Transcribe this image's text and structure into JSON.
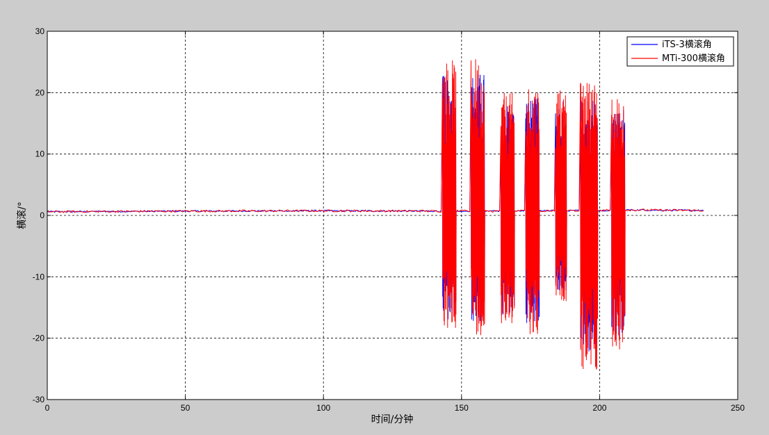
{
  "chart_data": {
    "type": "line",
    "title": "",
    "xlabel": "时间/分钟",
    "ylabel": "横滚/°",
    "xlim": [
      0,
      250
    ],
    "ylim": [
      -30,
      30
    ],
    "xticks": [
      0,
      50,
      100,
      150,
      200,
      250
    ],
    "yticks": [
      -30,
      -20,
      -10,
      0,
      10,
      20,
      30
    ],
    "xtick_labels": [
      "0",
      "50",
      "100",
      "150",
      "200",
      "250"
    ],
    "ytick_labels": [
      "-30",
      "-20",
      "-10",
      "0",
      "10",
      "20",
      "30"
    ],
    "grid": true,
    "legend_position": "top-right",
    "baseline": {
      "x": [
        0,
        50,
        100,
        143,
        160,
        200,
        208,
        238
      ],
      "y": [
        0.6,
        0.7,
        0.75,
        0.7,
        0.7,
        0.8,
        0.9,
        0.8
      ]
    },
    "bursts": [
      {
        "x": [
          143,
          148
        ],
        "min": -19,
        "max": 25.5
      },
      {
        "x": [
          153,
          158
        ],
        "min": -19.5,
        "max": 26
      },
      {
        "x": [
          164,
          169
        ],
        "min": -18.5,
        "max": 20
      },
      {
        "x": [
          173,
          178
        ],
        "min": -19.5,
        "max": 21.5
      },
      {
        "x": [
          184,
          188
        ],
        "min": -14,
        "max": 21
      },
      {
        "x": [
          193,
          199
        ],
        "min": -25.5,
        "max": 22
      },
      {
        "x": [
          204,
          209
        ],
        "min": -22,
        "max": 19.5
      }
    ],
    "series": [
      {
        "name": "iTS-3横滚角",
        "color": "#0000ff"
      },
      {
        "name": "MTi-300横滚角",
        "color": "#ff0000"
      }
    ]
  }
}
